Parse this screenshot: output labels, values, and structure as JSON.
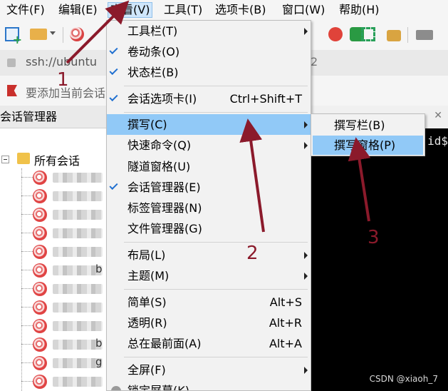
{
  "menubar": {
    "items": [
      "文件(F)",
      "编辑(E)",
      "查看(V)",
      "工具(T)",
      "选项卡(B)",
      "窗口(W)",
      "帮助(H)"
    ],
    "active": "查看(V)"
  },
  "toolbar": {
    "icons": [
      "new-session-icon",
      "open-folder-icon",
      "dropdown-arrow-icon",
      "sessions-ball-icon",
      "red-circle-icon",
      "green-icon",
      "expand-icon",
      "lock-icon",
      "keyboard-icon"
    ]
  },
  "address": {
    "url": "ssh://ubuntu",
    "suffix": "2"
  },
  "bookmarks": {
    "text": "要添加当前会话"
  },
  "session_panel": {
    "title": "会话管理器",
    "root": "所有会话",
    "session_extras": [
      "b",
      "b",
      "g"
    ]
  },
  "terminal": {
    "prompt": "id$"
  },
  "view_menu": {
    "items": [
      {
        "label": "工具栏(T)",
        "arrow": true
      },
      {
        "label": "卷动条(O)",
        "checked": true
      },
      {
        "label": "状态栏(B)",
        "checked": true
      },
      {
        "label": "会话选项卡(I)",
        "checked": true,
        "shortcut": "Ctrl+Shift+T"
      },
      {
        "label": "撰写(C)",
        "arrow": true,
        "highlighted": true
      },
      {
        "label": "快速命令(Q)",
        "arrow": true
      },
      {
        "label": "隧道窗格(U)"
      },
      {
        "label": "会话管理器(E)",
        "checked": true
      },
      {
        "label": "标签管理器(N)"
      },
      {
        "label": "文件管理器(G)"
      },
      {
        "label": "布局(L)",
        "arrow": true
      },
      {
        "label": "主题(M)",
        "arrow": true
      },
      {
        "label": "简单(S)",
        "shortcut": "Alt+S"
      },
      {
        "label": "透明(R)",
        "shortcut": "Alt+R"
      },
      {
        "label": "总在最前面(A)",
        "shortcut": "Alt+A"
      },
      {
        "label": "全屏(F)",
        "arrow": true
      },
      {
        "label": "锁定屏幕(K)"
      }
    ]
  },
  "compose_submenu": {
    "items": [
      {
        "label": "撰写栏(B)"
      },
      {
        "label": "撰写窗格(P)",
        "highlighted": true
      }
    ]
  },
  "annotations": {
    "labels": [
      "1",
      "2",
      "3"
    ],
    "color": "#8b1a2b"
  },
  "watermark": "CSDN @xiaoh_7",
  "colors": {
    "highlight": "#91c9f7",
    "check": "#1f6fd0",
    "menu_bg": "#f2f2f2"
  }
}
